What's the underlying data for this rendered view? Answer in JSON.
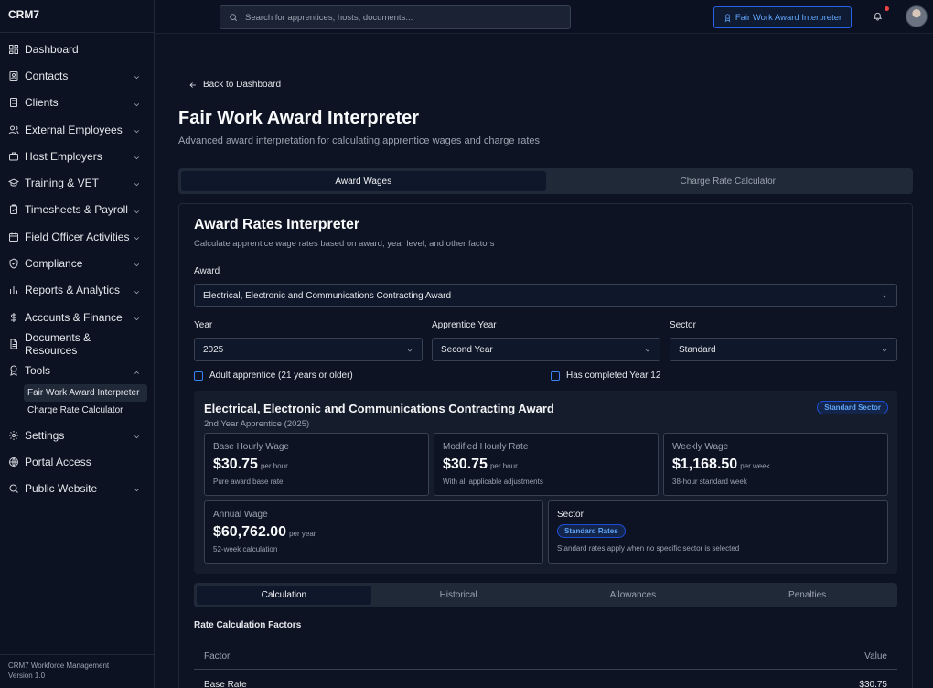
{
  "app": {
    "brand": "CRM7",
    "footer_line1": "CRM7 Workforce Management",
    "footer_line2": "Version 1.0"
  },
  "sidebar": {
    "items": [
      {
        "label": "Dashboard",
        "icon": "dashboard-icon"
      },
      {
        "label": "Contacts",
        "icon": "contacts-icon"
      },
      {
        "label": "Clients",
        "icon": "building-icon"
      },
      {
        "label": "External Employees",
        "icon": "users-icon"
      },
      {
        "label": "Host Employers",
        "icon": "briefcase-icon"
      },
      {
        "label": "Training & VET",
        "icon": "graduation-cap-icon"
      },
      {
        "label": "Timesheets & Payroll",
        "icon": "clipboard-icon"
      },
      {
        "label": "Field Officer Activities",
        "icon": "calendar-icon"
      },
      {
        "label": "Compliance",
        "icon": "shield-check-icon"
      },
      {
        "label": "Reports & Analytics",
        "icon": "bar-chart-icon"
      },
      {
        "label": "Accounts & Finance",
        "icon": "dollar-icon"
      },
      {
        "label": "Documents & Resources",
        "icon": "document-icon"
      },
      {
        "label": "Tools",
        "icon": "award-icon"
      },
      {
        "label": "Settings",
        "icon": "gear-icon"
      },
      {
        "label": "Portal Access",
        "icon": "globe-icon"
      },
      {
        "label": "Public Website",
        "icon": "search-icon"
      }
    ],
    "tools_sub": [
      {
        "label": "Fair Work Award Interpreter"
      },
      {
        "label": "Charge Rate Calculator"
      }
    ]
  },
  "topbar": {
    "search_placeholder": "Search for apprentices, hosts, documents...",
    "fw_button": "Fair Work Award Interpreter"
  },
  "page": {
    "back": "Back to Dashboard",
    "title": "Fair Work Award Interpreter",
    "subtitle": "Advanced award interpretation for calculating apprentice wages and charge rates",
    "tabs": [
      "Award Wages",
      "Charge Rate Calculator"
    ]
  },
  "card": {
    "title": "Award Rates Interpreter",
    "subtitle": "Calculate apprentice wage rates based on award, year level, and other factors",
    "award_label": "Award",
    "award_value": "Electrical, Electronic and Communications Contracting Award",
    "year_label": "Year",
    "year_value": "2025",
    "app_year_label": "Apprentice Year",
    "app_year_value": "Second Year",
    "sector_label": "Sector",
    "sector_value": "Standard",
    "adult_label": "Adult apprentice (21 years or older)",
    "year12_label": "Has completed Year 12"
  },
  "summary": {
    "title": "Electrical, Electronic and Communications Contracting Award",
    "subtitle": "2nd Year Apprentice (2025)",
    "badge": "Standard Sector",
    "base": {
      "label": "Base Hourly Wage",
      "value": "$30.75",
      "unit": "per hour",
      "note": "Pure award base rate"
    },
    "modified": {
      "label": "Modified Hourly Rate",
      "value": "$30.75",
      "unit": "per hour",
      "note": "With all applicable adjustments"
    },
    "weekly": {
      "label": "Weekly Wage",
      "value": "$1,168.50",
      "unit": "per week",
      "note": "38-hour standard week"
    },
    "annual": {
      "label": "Annual Wage",
      "value": "$60,762.00",
      "unit": "per year",
      "note": "52-week calculation"
    },
    "sector": {
      "label": "Sector",
      "badge": "Standard Rates",
      "note": "Standard rates apply when no specific sector is selected"
    }
  },
  "calc_tabs": [
    "Calculation",
    "Historical",
    "Allowances",
    "Penalties"
  ],
  "factors": {
    "title": "Rate Calculation Factors",
    "col_factor": "Factor",
    "col_value": "Value",
    "rows": [
      {
        "factor": "Base Rate",
        "value": "$30.75"
      }
    ]
  },
  "colors": {
    "accent": "#3b82f6",
    "notification": "#ef4444"
  }
}
